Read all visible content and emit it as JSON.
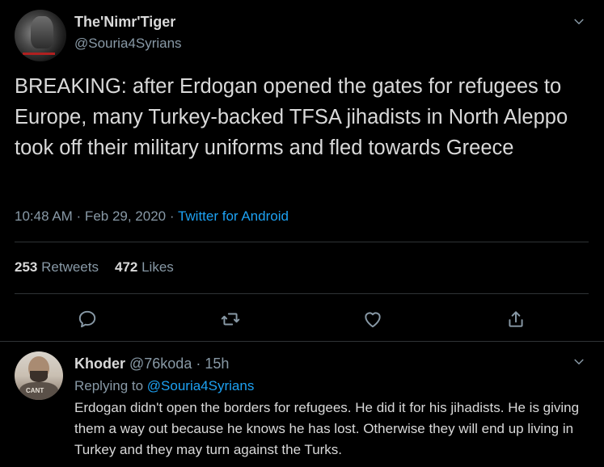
{
  "tweet": {
    "author_name": "The'Nimr'Tiger",
    "author_handle": "@Souria4Syrians",
    "text": "BREAKING: after Erdogan opened the gates for refugees to Europe, many Turkey-backed TFSA jihadists in North Aleppo took off their military uniforms and fled towards Greece",
    "time": "10:48 AM · Feb 29, 2020 · ",
    "source": "Twitter for Android",
    "retweets_count": "253",
    "retweets_label": "Retweets",
    "likes_count": "472",
    "likes_label": "Likes"
  },
  "reply": {
    "author_name": "Khoder",
    "author_handle_time": " @76koda · 15h",
    "replying_prefix": "Replying to ",
    "replying_to": "@Souria4Syrians",
    "text": "Erdogan didn't open the borders for refugees. He did it for his jihadists. He is giving them a way out because he knows he has lost. Otherwise they will end up living in Turkey and they may turn against the Turks.",
    "avatar_shirt_text": "CANT"
  },
  "icons": {
    "more": "chevron-down-icon",
    "reply": "reply-icon",
    "retweet": "retweet-icon",
    "like": "heart-icon",
    "share": "share-icon"
  },
  "colors": {
    "background": "#000000",
    "text": "#d9d9d9",
    "secondary": "#8899a6",
    "accent": "#1da1f2",
    "divider": "#2f3336"
  }
}
